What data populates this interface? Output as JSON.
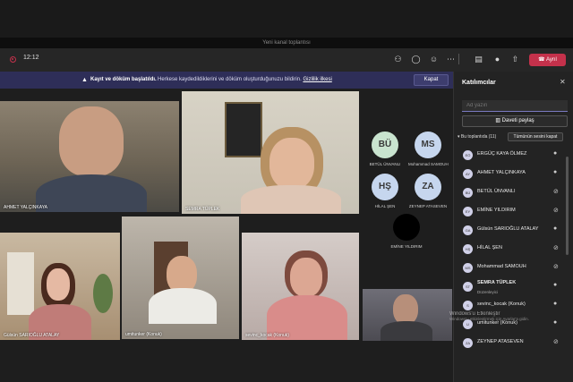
{
  "window": {
    "title": "Yeni kanal toplantısı"
  },
  "toolbar": {
    "timer": "12:12",
    "leave_label": "Ayrıl",
    "icons": [
      "people-icon",
      "chat-icon",
      "reactions-icon",
      "more-icon",
      "camera-icon",
      "mic-icon",
      "share-icon"
    ]
  },
  "banner": {
    "bold": "Kayıt ve döküm başlatıldı.",
    "text": "Herkese kaydedildiklerini ve döküm oluşturduğunuzu bildirin.",
    "link": "Gizlilik ilkesi",
    "close_label": "Kapat"
  },
  "tiles": [
    {
      "name": "AHMET YALÇINKAYA"
    },
    {
      "name": "SEMRA TÜPLEK"
    },
    {
      "name": "Gülsün SARIOĞLU ATALAY"
    },
    {
      "name": "umitunker (Konuk)"
    },
    {
      "name": "sevinc_kocak (Konuk)"
    }
  ],
  "avatars": [
    {
      "initials": "BÜ",
      "label": "BETÜL ÜNVANLI",
      "color": "#c9e4cf"
    },
    {
      "initials": "MS",
      "label": "Mohammad SAMOUH",
      "color": "#c6d6ee"
    },
    {
      "initials": "HŞ",
      "label": "HİLAL ŞEN",
      "color": "#c6d6ee"
    },
    {
      "initials": "ZA",
      "label": "ZEYNEP ATASEVEN",
      "color": "#c6d6ee"
    },
    {
      "initials": "",
      "label": "EMİNE YILDIRIM",
      "color": "#000000"
    }
  ],
  "panel": {
    "title": "Katılımcılar",
    "search_placeholder": "Ad yazın",
    "invite_label": "Daveti paylaş",
    "in_meeting": "Bu toplantıda (11)",
    "mute_all": "Tümünün sesini kapat",
    "participants": [
      {
        "initials": "EÖ",
        "name": "ERGÜÇ KAYA ÖLMEZ",
        "role": ""
      },
      {
        "initials": "AY",
        "name": "AHMET YALÇINKAYA",
        "role": ""
      },
      {
        "initials": "BÜ",
        "name": "BETÜL ÜNVANLI",
        "role": ""
      },
      {
        "initials": "EY",
        "name": "EMİNE YILDIRIM",
        "role": ""
      },
      {
        "initials": "GA",
        "name": "Gülsün SARIOĞLU ATALAY",
        "role": ""
      },
      {
        "initials": "HŞ",
        "name": "HİLAL ŞEN",
        "role": ""
      },
      {
        "initials": "MS",
        "name": "Mohammad SAMOUH",
        "role": ""
      },
      {
        "initials": "ST",
        "name": "SEMRA TÜPLEK",
        "role": "Düzenleyici"
      },
      {
        "initials": "S",
        "name": "sevinc_kocak (Konuk)",
        "role": ""
      },
      {
        "initials": "U",
        "name": "umitunker (Konuk)",
        "role": ""
      },
      {
        "initials": "ZA",
        "name": "ZEYNEP ATASEVEN",
        "role": ""
      }
    ]
  },
  "watermark": {
    "line1": "Windows'u Etkinleştir",
    "line2": "Windows'u etkinleştirmek için Ayarlar'a gidin."
  }
}
